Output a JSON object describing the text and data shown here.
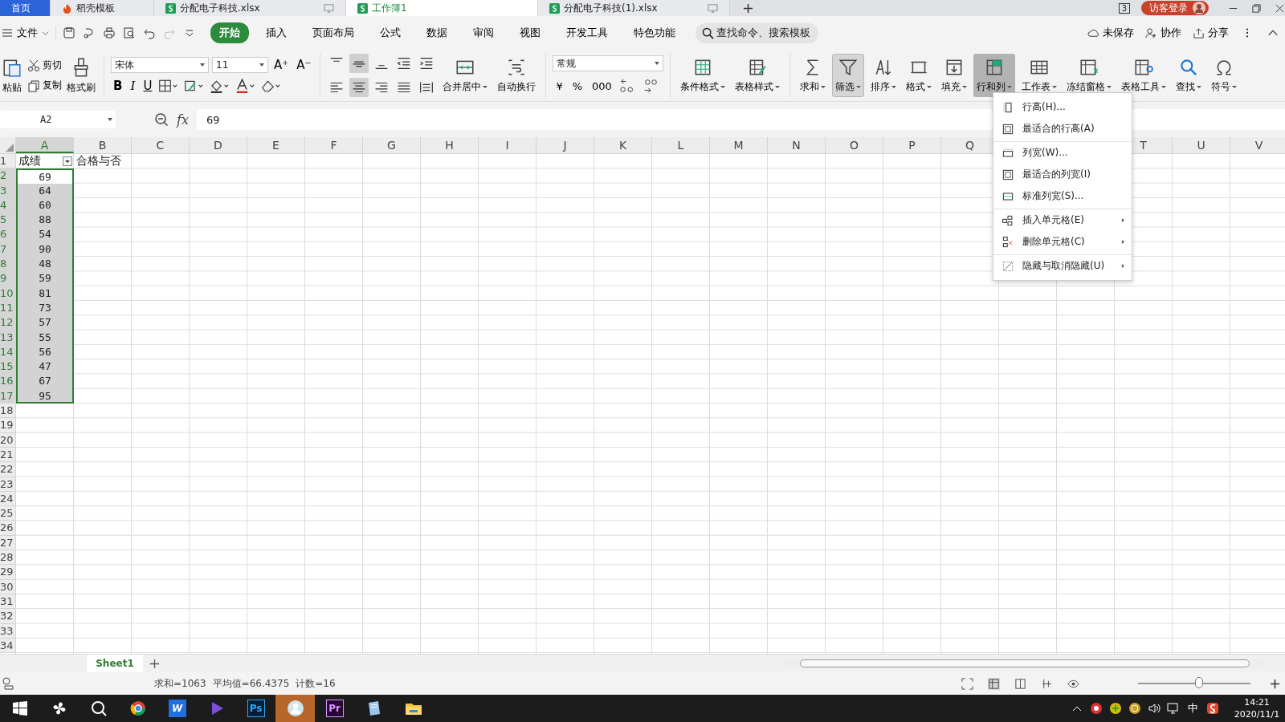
{
  "tabs": [
    {
      "label": "首页",
      "kind": "home",
      "selected": false
    },
    {
      "label": "稻壳模板",
      "kind": "docer",
      "selected": false
    },
    {
      "label": "分配电子科技.xlsx",
      "kind": "sheet",
      "selected": false
    },
    {
      "label": "工作簿1",
      "kind": "sheet",
      "selected": true
    },
    {
      "label": "分配电子科技(1).xlsx",
      "kind": "sheet",
      "selected": false
    }
  ],
  "window_count": "3",
  "login": "访客登录",
  "menu": {
    "file": "文件",
    "tabs": [
      {
        "label": "开始",
        "selected": true
      },
      {
        "label": "插入",
        "selected": false
      },
      {
        "label": "页面布局",
        "selected": false
      },
      {
        "label": "公式",
        "selected": false
      },
      {
        "label": "数据",
        "selected": false
      },
      {
        "label": "审阅",
        "selected": false
      },
      {
        "label": "视图",
        "selected": false
      },
      {
        "label": "开发工具",
        "selected": false
      },
      {
        "label": "特色功能",
        "selected": false
      }
    ],
    "search": "查找命令、搜索模板",
    "actions": [
      "未保存",
      "协作",
      "分享"
    ]
  },
  "ribbon": {
    "paste": "粘贴",
    "cut": "剪切",
    "copy": "复制",
    "painter": "格式刷",
    "font": "宋体",
    "font_size": "11",
    "grow": "A⁺",
    "shrink": "A⁻",
    "styles": [
      "B",
      "I",
      "U"
    ],
    "align_top": [
      {
        "kind": "top",
        "pressed": false
      },
      {
        "kind": "middle",
        "pressed": true
      },
      {
        "kind": "bottom",
        "pressed": false
      },
      {
        "kind": "outdent",
        "pressed": false
      },
      {
        "kind": "indent",
        "pressed": false
      }
    ],
    "align_bottom": [
      {
        "kind": "left",
        "pressed": false
      },
      {
        "kind": "center",
        "pressed": true
      },
      {
        "kind": "right",
        "pressed": false
      },
      {
        "kind": "justify",
        "pressed": false
      },
      {
        "kind": "distribute",
        "pressed": false
      }
    ],
    "number_format": "常规",
    "number_buttons": [
      "¥",
      "%",
      "000"
    ],
    "large": [
      {
        "label": "合并居中",
        "kind": "merge",
        "dropdown": true,
        "pressed": false,
        "open": false
      },
      {
        "label": "自动换行",
        "kind": "wrap",
        "dropdown": false,
        "pressed": false,
        "open": false
      },
      {
        "label": "条件格式",
        "kind": "cond",
        "dropdown": true,
        "pressed": false,
        "open": false
      },
      {
        "label": "表格样式",
        "kind": "style",
        "dropdown": true,
        "pressed": false,
        "open": false
      }
    ],
    "tools": [
      {
        "label": "求和",
        "kind": "sum",
        "dropdown": true,
        "pressed": false,
        "open": false
      },
      {
        "label": "筛选",
        "kind": "filter",
        "dropdown": true,
        "pressed": true,
        "open": false
      },
      {
        "label": "排序",
        "kind": "sort",
        "dropdown": true,
        "pressed": false,
        "open": false
      },
      {
        "label": "格式",
        "kind": "format",
        "dropdown": true,
        "pressed": false,
        "open": false
      },
      {
        "label": "填充",
        "kind": "fill",
        "dropdown": true,
        "pressed": false,
        "open": false
      },
      {
        "label": "行和列",
        "kind": "rowcol",
        "dropdown": true,
        "pressed": false,
        "open": true
      },
      {
        "label": "工作表",
        "kind": "sheet",
        "dropdown": true,
        "pressed": false,
        "open": false
      },
      {
        "label": "冻结窗格",
        "kind": "freeze",
        "dropdown": true,
        "pressed": false,
        "open": false
      },
      {
        "label": "表格工具",
        "kind": "tools",
        "dropdown": true,
        "pressed": false,
        "open": false
      },
      {
        "label": "查找",
        "kind": "find",
        "dropdown": true,
        "pressed": false,
        "open": false
      },
      {
        "label": "符号",
        "kind": "symbol",
        "dropdown": true,
        "pressed": false,
        "open": false
      }
    ]
  },
  "formula_bar": {
    "name_box": "A2",
    "fx": "fx",
    "value": "69"
  },
  "columns": [
    {
      "label": "A",
      "selected": true
    },
    {
      "label": "B",
      "selected": false
    },
    {
      "label": "C",
      "selected": false
    },
    {
      "label": "D",
      "selected": false
    },
    {
      "label": "E",
      "selected": false
    },
    {
      "label": "F",
      "selected": false
    },
    {
      "label": "G",
      "selected": false
    },
    {
      "label": "H",
      "selected": false
    },
    {
      "label": "I",
      "selected": false
    },
    {
      "label": "J",
      "selected": false
    },
    {
      "label": "K",
      "selected": false
    },
    {
      "label": "L",
      "selected": false
    },
    {
      "label": "M",
      "selected": false
    },
    {
      "label": "N",
      "selected": false
    },
    {
      "label": "O",
      "selected": false
    },
    {
      "label": "P",
      "selected": false
    },
    {
      "label": "Q",
      "selected": false
    },
    {
      "label": "T",
      "selected": false
    },
    {
      "label": "U",
      "selected": false
    },
    {
      "label": "V",
      "selected": false
    }
  ],
  "rows": [
    {
      "number": "1",
      "selected": false,
      "cells": [
        {
          "value": "成绩",
          "filter": true,
          "selected": false
        },
        {
          "value": "合格与否",
          "filter": false,
          "selected": false
        }
      ]
    },
    {
      "number": "2",
      "selected": true,
      "cells": [
        {
          "value": "69",
          "filter": false,
          "selected": true,
          "active": true
        }
      ]
    },
    {
      "number": "3",
      "selected": true,
      "cells": [
        {
          "value": "64",
          "filter": false,
          "selected": true
        }
      ]
    },
    {
      "number": "4",
      "selected": true,
      "cells": [
        {
          "value": "60",
          "filter": false,
          "selected": true
        }
      ]
    },
    {
      "number": "5",
      "selected": true,
      "cells": [
        {
          "value": "88",
          "filter": false,
          "selected": true
        }
      ]
    },
    {
      "number": "6",
      "selected": true,
      "cells": [
        {
          "value": "54",
          "filter": false,
          "selected": true
        }
      ]
    },
    {
      "number": "7",
      "selected": true,
      "cells": [
        {
          "value": "90",
          "filter": false,
          "selected": true
        }
      ]
    },
    {
      "number": "8",
      "selected": true,
      "cells": [
        {
          "value": "48",
          "filter": false,
          "selected": true
        }
      ]
    },
    {
      "number": "9",
      "selected": true,
      "cells": [
        {
          "value": "59",
          "filter": false,
          "selected": true
        }
      ]
    },
    {
      "number": "10",
      "selected": true,
      "cells": [
        {
          "value": "81",
          "filter": false,
          "selected": true
        }
      ]
    },
    {
      "number": "11",
      "selected": true,
      "cells": [
        {
          "value": "73",
          "filter": false,
          "selected": true
        }
      ]
    },
    {
      "number": "12",
      "selected": true,
      "cells": [
        {
          "value": "57",
          "filter": false,
          "selected": true
        }
      ]
    },
    {
      "number": "13",
      "selected": true,
      "cells": [
        {
          "value": "55",
          "filter": false,
          "selected": true
        }
      ]
    },
    {
      "number": "14",
      "selected": true,
      "cells": [
        {
          "value": "56",
          "filter": false,
          "selected": true
        }
      ]
    },
    {
      "number": "15",
      "selected": true,
      "cells": [
        {
          "value": "47",
          "filter": false,
          "selected": true
        }
      ]
    },
    {
      "number": "16",
      "selected": true,
      "cells": [
        {
          "value": "67",
          "filter": false,
          "selected": true
        }
      ]
    },
    {
      "number": "17",
      "selected": true,
      "cells": [
        {
          "value": "95",
          "filter": false,
          "selected": true
        }
      ]
    },
    {
      "number": "18",
      "selected": false,
      "cells": []
    },
    {
      "number": "19",
      "selected": false,
      "cells": []
    },
    {
      "number": "20",
      "selected": false,
      "cells": []
    },
    {
      "number": "21",
      "selected": false,
      "cells": []
    },
    {
      "number": "22",
      "selected": false,
      "cells": []
    },
    {
      "number": "23",
      "selected": false,
      "cells": []
    },
    {
      "number": "24",
      "selected": false,
      "cells": []
    },
    {
      "number": "25",
      "selected": false,
      "cells": []
    },
    {
      "number": "26",
      "selected": false,
      "cells": []
    },
    {
      "number": "27",
      "selected": false,
      "cells": []
    },
    {
      "number": "28",
      "selected": false,
      "cells": []
    },
    {
      "number": "29",
      "selected": false,
      "cells": []
    },
    {
      "number": "30",
      "selected": false,
      "cells": []
    },
    {
      "number": "31",
      "selected": false,
      "cells": []
    },
    {
      "number": "32",
      "selected": false,
      "cells": []
    },
    {
      "number": "33",
      "selected": false,
      "cells": []
    },
    {
      "number": "34",
      "selected": false,
      "cells": []
    }
  ],
  "dropdown": {
    "items": [
      {
        "label": "行高(H)...",
        "kind": "row-height",
        "separator_before": false,
        "submenu": false
      },
      {
        "label": "最适合的行高(A)",
        "kind": "autofit",
        "separator_before": false,
        "submenu": false
      },
      {
        "label": "列宽(W)...",
        "kind": "col-width",
        "separator_before": true,
        "submenu": false
      },
      {
        "label": "最适合的列宽(I)",
        "kind": "autofit",
        "separator_before": false,
        "submenu": false
      },
      {
        "label": "标准列宽(S)...",
        "kind": "std-width",
        "separator_before": false,
        "submenu": false
      },
      {
        "label": "插入单元格(E)",
        "kind": "insert",
        "separator_before": true,
        "submenu": true
      },
      {
        "label": "删除单元格(C)",
        "kind": "delete",
        "separator_before": false,
        "submenu": true
      },
      {
        "label": "隐藏与取消隐藏(U)",
        "kind": "hide",
        "separator_before": true,
        "submenu": true
      }
    ]
  },
  "sheets": [
    {
      "label": "Sheet1",
      "selected": true
    }
  ],
  "status": [
    "求和=1063",
    "平均值=66.4375",
    "计数=16"
  ],
  "zoom": {
    "level": 0.55
  },
  "taskbar": {
    "apps": [
      {
        "kind": "start",
        "active": false
      },
      {
        "kind": "fan",
        "active": false
      },
      {
        "kind": "search",
        "active": false
      },
      {
        "kind": "browser",
        "active": false
      },
      {
        "kind": "wps",
        "label": "W",
        "active": false
      },
      {
        "kind": "play",
        "active": false
      },
      {
        "kind": "ps",
        "label": "Ps",
        "active": false
      },
      {
        "kind": "avatar",
        "active": true
      },
      {
        "kind": "pr",
        "label": "Pr",
        "active": false
      },
      {
        "kind": "notes",
        "active": false
      },
      {
        "kind": "folder",
        "active": false
      }
    ],
    "ime": "中",
    "time": "14:21",
    "date": "2020/11/1"
  }
}
